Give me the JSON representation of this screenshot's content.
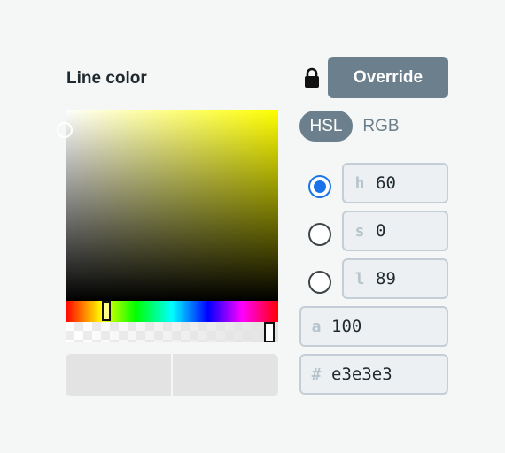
{
  "panel": {
    "title": "Line color",
    "override_label": "Override"
  },
  "modes": {
    "hsl": "HSL",
    "rgb": "RGB",
    "active": "HSL"
  },
  "color": {
    "hex_value": "#e3e3e3",
    "hue_base": "#ffff00"
  },
  "channels": [
    {
      "label": "h",
      "value": "60",
      "selected": true
    },
    {
      "label": "s",
      "value": "0",
      "selected": false
    },
    {
      "label": "l",
      "value": "89",
      "selected": false
    }
  ],
  "alpha": {
    "label": "a",
    "value": "100"
  },
  "hex": {
    "label": "#",
    "value": "e3e3e3"
  },
  "icons": {
    "lock": "lock-icon"
  }
}
